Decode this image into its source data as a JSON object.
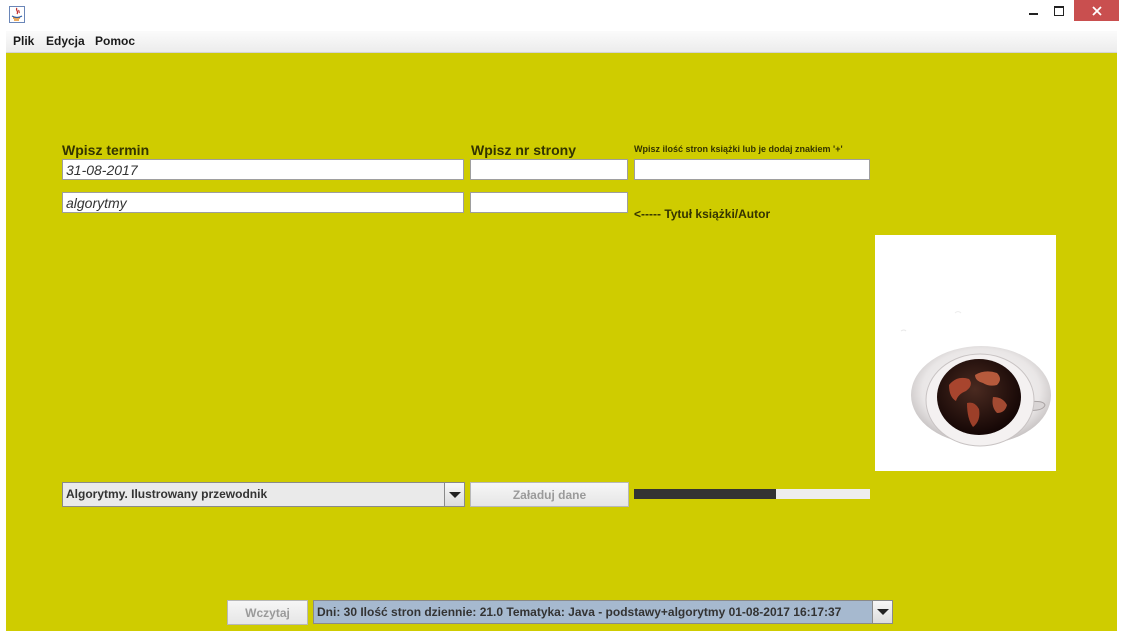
{
  "window": {
    "title": ""
  },
  "menu": {
    "items": [
      {
        "label": "Plik"
      },
      {
        "label": "Edycja"
      },
      {
        "label": "Pomoc"
      }
    ]
  },
  "form": {
    "deadline_label": "Wpisz termin",
    "page_label": "Wpisz nr strony",
    "pages_count_label": "Wpisz ilość stron książki lub je dodaj znakiem '+'",
    "deadline_value": "31-08-2017",
    "page_value": "",
    "pages_count_value": "",
    "title_value": "algorytmy",
    "title_page_value": "",
    "title_hint": "<-----  Tytuł książki/Autor"
  },
  "book_select": {
    "selected": "Algorytmy. Ilustrowany przewodnik"
  },
  "load_button": {
    "label": "Załaduj dane"
  },
  "progress": {
    "fraction": 0.6
  },
  "footer": {
    "read_button": "Wczytaj",
    "summary_selected": "Dni: 30 Ilość stron dziennie: 21.0 Tematyka: Java - podstawy+algorytmy 01-08-2017 16:17:37"
  },
  "colors": {
    "background": "#cfcc00",
    "label_text": "#333300",
    "close_button": "#c94f4f",
    "summary_combo": "#a6b9cf"
  },
  "icons": [
    "java-app-icon",
    "minimize-icon",
    "maximize-icon",
    "close-icon",
    "dropdown-arrow-icon",
    "coffee-cup-globe-image"
  ]
}
